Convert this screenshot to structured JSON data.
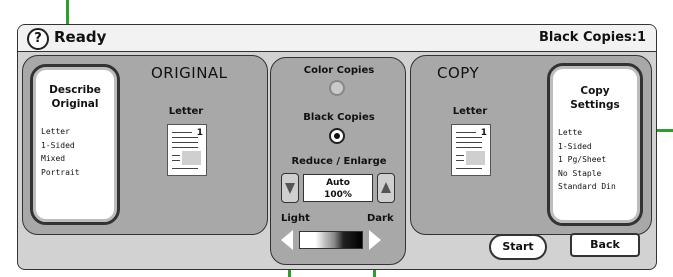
{
  "header": {
    "status": "Ready",
    "copies_label": "Black Copies:1"
  },
  "original": {
    "heading": "ORIGINAL",
    "describe_button": {
      "title_line1": "Describe",
      "title_line2": "Original",
      "items": [
        "Letter",
        "1-Sided",
        "Mixed",
        "Portrait"
      ]
    },
    "paper_label": "Letter",
    "page_number": "1"
  },
  "center": {
    "color_copies_label": "Color Copies",
    "black_copies_label": "Black Copies",
    "reduce_enlarge_label": "Reduce / Enlarge",
    "zoom_mode": "Auto",
    "zoom_value": "100%",
    "light_label": "Light",
    "dark_label": "Dark"
  },
  "copy": {
    "heading": "COPY",
    "paper_label": "Letter",
    "page_number": "1",
    "settings_button": {
      "title_line1": "Copy",
      "title_line2": "Settings",
      "items": [
        "Lette",
        "1-Sided",
        "1 Pg/Sheet",
        "No Staple",
        "Standard Din"
      ]
    }
  },
  "actions": {
    "start": "Start",
    "back": "Back"
  },
  "colors": {
    "callout": "#2e9e2e",
    "panel": "#d2d2d2",
    "section": "#a8a8a8"
  }
}
